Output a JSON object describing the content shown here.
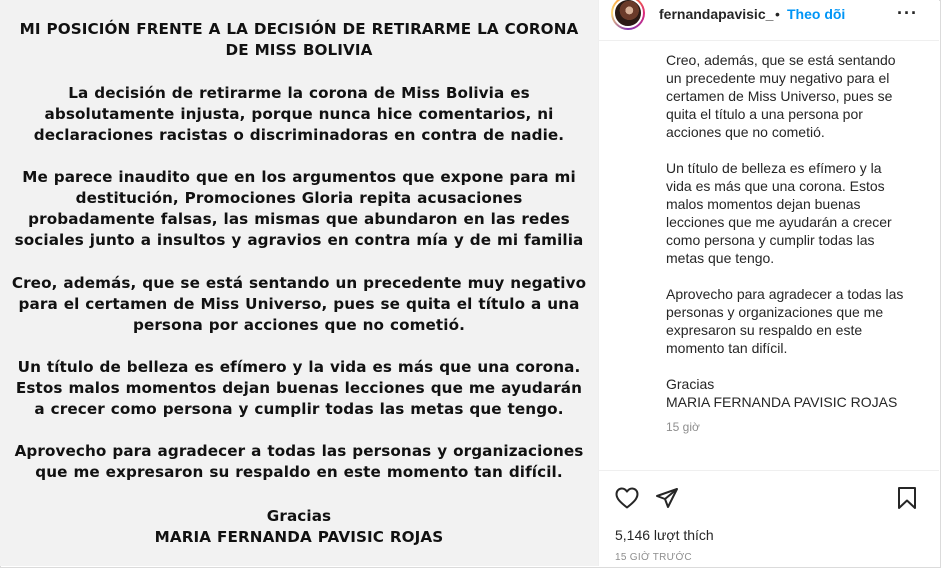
{
  "statement": {
    "title": "MI POSICIÓN FRENTE A LA DECISIÓN DE RETIRARME LA CORONA DE MISS BOLIVIA",
    "paragraphs": [
      "La decisión de retirarme la corona de Miss Bolivia es absolutamente injusta, porque nunca hice comentarios, ni declaraciones racistas o discriminadoras en contra de nadie.",
      "Me parece inaudito que en los argumentos que expone para mi destitución, Promociones Gloria repita acusaciones probadamente falsas, las mismas que abundaron en las redes sociales junto a insultos y agravios en contra mía y de mi familia",
      "Creo, además, que se está sentando un precedente muy negativo para el certamen de Miss Universo, pues se quita el título a una persona por acciones que no cometió.",
      "Un título de belleza es efímero y la vida es más que una corona. Estos malos momentos dejan buenas lecciones que me ayudarán a crecer como persona y cumplir todas las metas que tengo.",
      "Aprovecho para agradecer a todas las personas y organizaciones que me expresaron su respaldo en este momento tan difícil.",
      "Gracias",
      "MARIA FERNANDA PAVISIC ROJAS"
    ]
  },
  "header": {
    "username": "fernandapavisic_",
    "separator": "•",
    "follow_label": "Theo dõi",
    "more_label": "···"
  },
  "caption": {
    "paragraphs": [
      "Creo, además, que se está sentando un precedente muy negativo para el certamen de Miss Universo, pues se quita el título a una persona por acciones que no cometió.",
      "Un título de belleza es efímero y la vida es más que una corona. Estos malos momentos dejan buenas lecciones que me ayudarán a crecer como persona y cumplir todas las metas que tengo.",
      "Aprovecho para agradecer a todas las personas y organizaciones que me expresaron su respaldo en este momento tan difícil.",
      "Gracias",
      "MARIA FERNANDA PAVISIC ROJAS"
    ],
    "time_ago": "15 giờ"
  },
  "actions": {
    "likes_text": "5,146 lượt thích",
    "timestamp": "15 GIỜ TRƯỚC"
  },
  "icons": [
    "heart-icon",
    "share-icon",
    "bookmark-icon",
    "more-icon"
  ],
  "colors": {
    "link": "#0095f6",
    "muted": "#8e8e8e",
    "text": "#262626"
  }
}
